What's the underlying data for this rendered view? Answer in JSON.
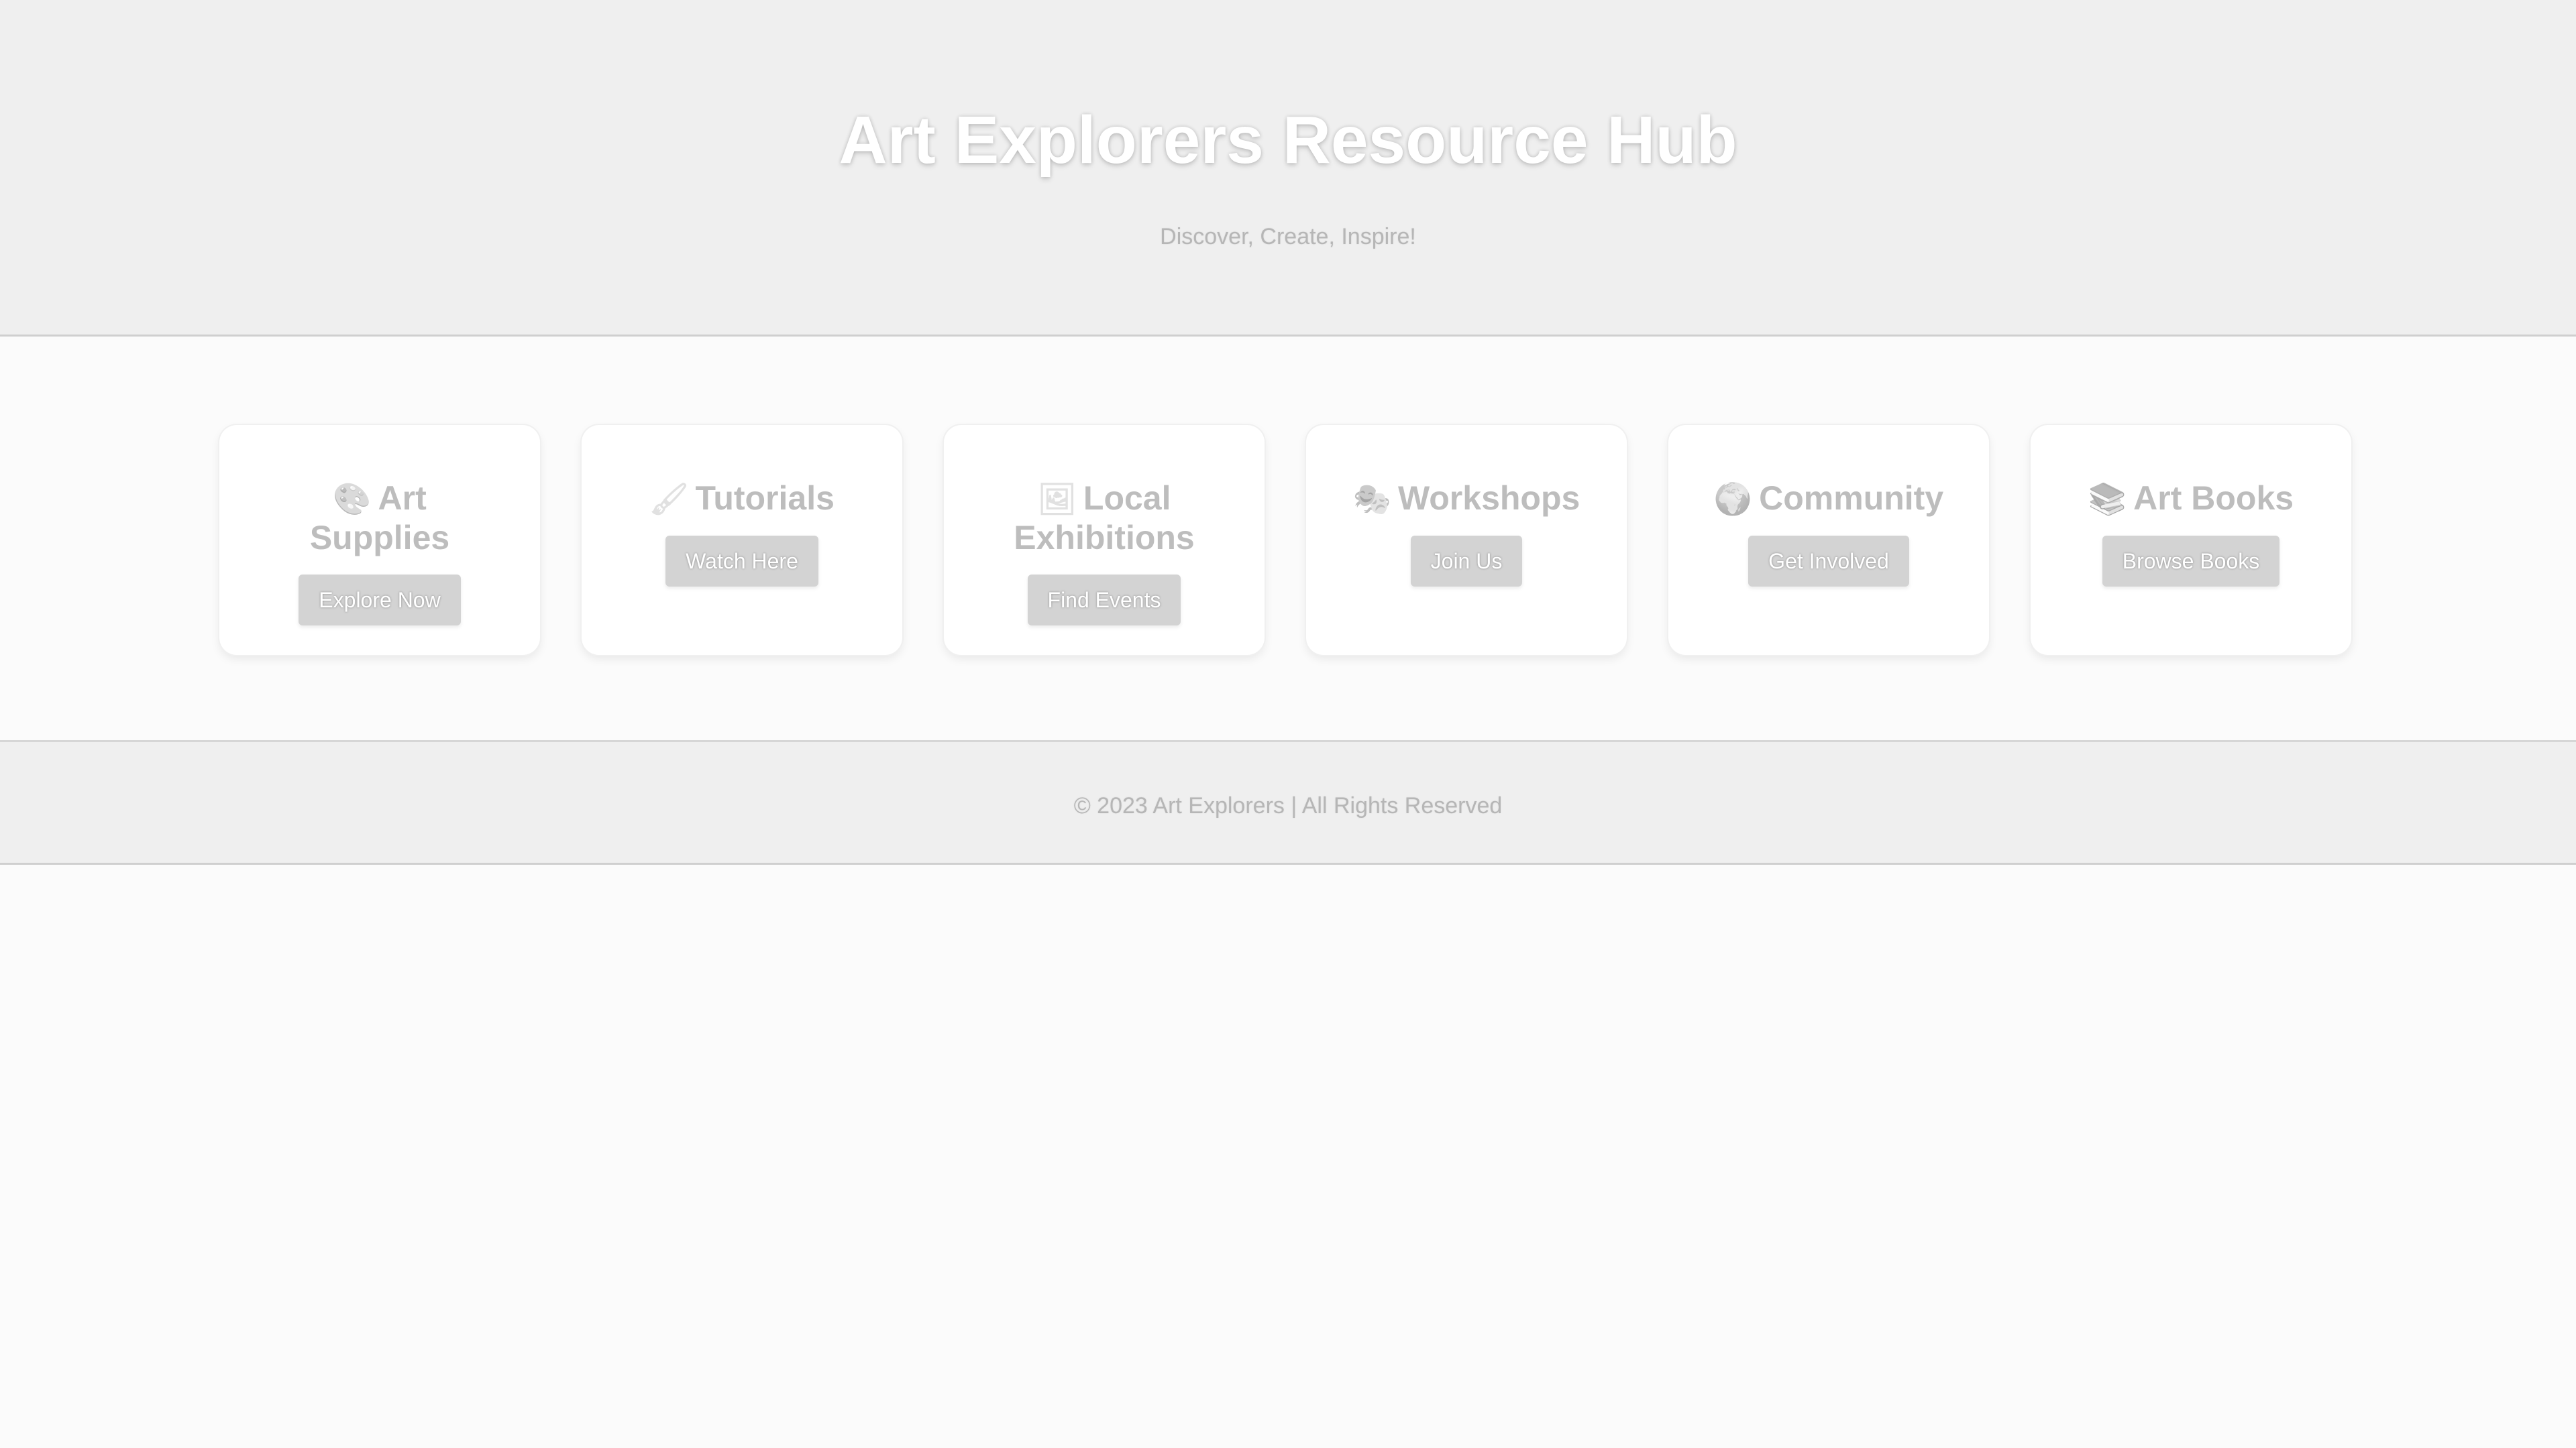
{
  "header": {
    "title": "Art Explorers Resource Hub",
    "subtitle": "Discover, Create, Inspire!"
  },
  "cards": [
    {
      "icon": "🎨",
      "icon_name": "palette-icon",
      "title": "Art Supplies",
      "button": "Explore Now"
    },
    {
      "icon": "🖌",
      "icon_name": "paintbrush-icon",
      "title": "Tutorials",
      "button": "Watch Here"
    },
    {
      "icon": "🖼",
      "icon_name": "framed-picture-icon",
      "title": "Local Exhibitions",
      "button": "Find Events"
    },
    {
      "icon": "🎭",
      "icon_name": "masks-icon",
      "title": "Workshops",
      "button": "Join Us"
    },
    {
      "icon": "🌍",
      "icon_name": "globe-icon",
      "title": "Community",
      "button": "Get Involved"
    },
    {
      "icon": "📚",
      "icon_name": "books-icon",
      "title": "Art Books",
      "button": "Browse Books"
    }
  ],
  "footer": {
    "text": "© 2023 Art Explorers | All Rights Reserved"
  },
  "colors": {
    "header_bg": "#efefef",
    "page_bg": "#fbfbfb",
    "button_bg": "#d3d3d3",
    "card_title": "#bdbdbd"
  }
}
